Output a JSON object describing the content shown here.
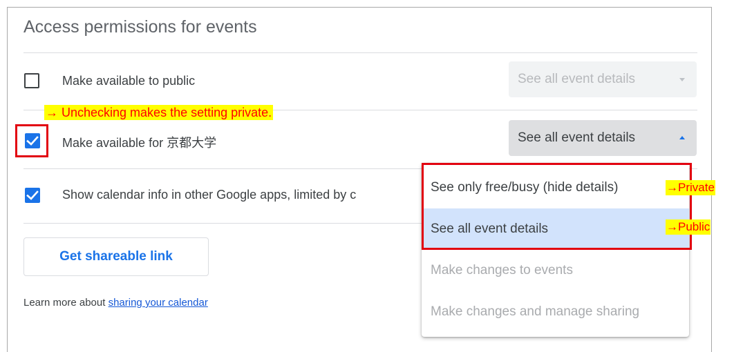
{
  "panel": {
    "title": "Access permissions for events"
  },
  "rows": [
    {
      "label": "Make available to public",
      "checked": false,
      "select_value": "See all event details",
      "select_state": "disabled"
    },
    {
      "label": "Make available for 京都大学",
      "checked": true,
      "select_value": "See all event details",
      "select_state": "open"
    },
    {
      "label": "Show calendar info in other Google apps, limited by c",
      "checked": true
    }
  ],
  "dropdown_menu": {
    "items": [
      {
        "label": "See only free/busy (hide details)",
        "enabled": true,
        "selected": false
      },
      {
        "label": "See all event details",
        "enabled": true,
        "selected": true
      },
      {
        "label": "Make changes to events",
        "enabled": false,
        "selected": false
      },
      {
        "label": "Make changes and manage sharing",
        "enabled": false,
        "selected": false
      }
    ]
  },
  "shareable_link_button": "Get shareable link",
  "learn_more": {
    "prefix": "Learn more about ",
    "link_text": "sharing your calendar"
  },
  "annotations": {
    "uncheck_note": "→ Unchecking makes the setting private.",
    "private_label": "→Private",
    "public_label": "→Public"
  },
  "colors": {
    "accent": "#1a73e8",
    "annotation_red": "#e2000f",
    "highlight_yellow": "#ffff00",
    "selected_item_bg": "#d2e3fc"
  }
}
